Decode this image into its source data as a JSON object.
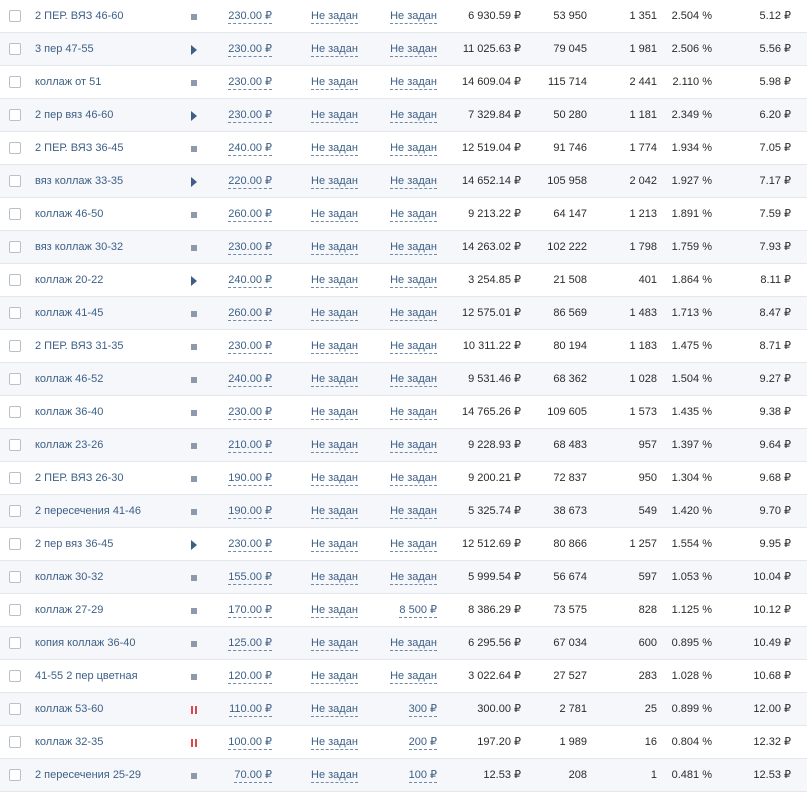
{
  "currency": "₽",
  "rows": [
    {
      "name": "2 ПЕР. ВЯЗ 46-60",
      "status": "active",
      "bid": "230.00 ₽",
      "limit_day": "Не задан",
      "limit_total": "Не задан",
      "spent": "6 930.59 ₽",
      "impressions": "53 950",
      "clicks": "1 351",
      "ctr": "2.504 %",
      "cpc": "5.12 ₽"
    },
    {
      "name": "3 пер 47-55",
      "status": "play",
      "bid": "230.00 ₽",
      "limit_day": "Не задан",
      "limit_total": "Не задан",
      "spent": "11 025.63 ₽",
      "impressions": "79 045",
      "clicks": "1 981",
      "ctr": "2.506 %",
      "cpc": "5.56 ₽"
    },
    {
      "name": "коллаж от 51",
      "status": "active",
      "bid": "230.00 ₽",
      "limit_day": "Не задан",
      "limit_total": "Не задан",
      "spent": "14 609.04 ₽",
      "impressions": "115 714",
      "clicks": "2 441",
      "ctr": "2.110 %",
      "cpc": "5.98 ₽"
    },
    {
      "name": "2 пер вяз 46-60",
      "status": "play",
      "bid": "230.00 ₽",
      "limit_day": "Не задан",
      "limit_total": "Не задан",
      "spent": "7 329.84 ₽",
      "impressions": "50 280",
      "clicks": "1 181",
      "ctr": "2.349 %",
      "cpc": "6.20 ₽"
    },
    {
      "name": "2 ПЕР. ВЯЗ 36-45",
      "status": "active",
      "bid": "240.00 ₽",
      "limit_day": "Не задан",
      "limit_total": "Не задан",
      "spent": "12 519.04 ₽",
      "impressions": "91 746",
      "clicks": "1 774",
      "ctr": "1.934 %",
      "cpc": "7.05 ₽"
    },
    {
      "name": "вяз коллаж 33-35",
      "status": "play",
      "bid": "220.00 ₽",
      "limit_day": "Не задан",
      "limit_total": "Не задан",
      "spent": "14 652.14 ₽",
      "impressions": "105 958",
      "clicks": "2 042",
      "ctr": "1.927 %",
      "cpc": "7.17 ₽"
    },
    {
      "name": "коллаж 46-50",
      "status": "active",
      "bid": "260.00 ₽",
      "limit_day": "Не задан",
      "limit_total": "Не задан",
      "spent": "9 213.22 ₽",
      "impressions": "64 147",
      "clicks": "1 213",
      "ctr": "1.891 %",
      "cpc": "7.59 ₽"
    },
    {
      "name": "вяз коллаж 30-32",
      "status": "active",
      "bid": "230.00 ₽",
      "limit_day": "Не задан",
      "limit_total": "Не задан",
      "spent": "14 263.02 ₽",
      "impressions": "102 222",
      "clicks": "1 798",
      "ctr": "1.759 %",
      "cpc": "7.93 ₽"
    },
    {
      "name": "коллаж 20-22",
      "status": "play",
      "bid": "240.00 ₽",
      "limit_day": "Не задан",
      "limit_total": "Не задан",
      "spent": "3 254.85 ₽",
      "impressions": "21 508",
      "clicks": "401",
      "ctr": "1.864 %",
      "cpc": "8.11 ₽"
    },
    {
      "name": "коллаж 41-45",
      "status": "active",
      "bid": "260.00 ₽",
      "limit_day": "Не задан",
      "limit_total": "Не задан",
      "spent": "12 575.01 ₽",
      "impressions": "86 569",
      "clicks": "1 483",
      "ctr": "1.713 %",
      "cpc": "8.47 ₽"
    },
    {
      "name": "2 ПЕР. ВЯЗ 31-35",
      "status": "active",
      "bid": "230.00 ₽",
      "limit_day": "Не задан",
      "limit_total": "Не задан",
      "spent": "10 311.22 ₽",
      "impressions": "80 194",
      "clicks": "1 183",
      "ctr": "1.475 %",
      "cpc": "8.71 ₽"
    },
    {
      "name": "коллаж 46-52",
      "status": "active",
      "bid": "240.00 ₽",
      "limit_day": "Не задан",
      "limit_total": "Не задан",
      "spent": "9 531.46 ₽",
      "impressions": "68 362",
      "clicks": "1 028",
      "ctr": "1.504 %",
      "cpc": "9.27 ₽"
    },
    {
      "name": "коллаж 36-40",
      "status": "active",
      "bid": "230.00 ₽",
      "limit_day": "Не задан",
      "limit_total": "Не задан",
      "spent": "14 765.26 ₽",
      "impressions": "109 605",
      "clicks": "1 573",
      "ctr": "1.435 %",
      "cpc": "9.38 ₽"
    },
    {
      "name": "коллаж 23-26",
      "status": "active",
      "bid": "210.00 ₽",
      "limit_day": "Не задан",
      "limit_total": "Не задан",
      "spent": "9 228.93 ₽",
      "impressions": "68 483",
      "clicks": "957",
      "ctr": "1.397 %",
      "cpc": "9.64 ₽"
    },
    {
      "name": "2 ПЕР. ВЯЗ 26-30",
      "status": "active",
      "bid": "190.00 ₽",
      "limit_day": "Не задан",
      "limit_total": "Не задан",
      "spent": "9 200.21 ₽",
      "impressions": "72 837",
      "clicks": "950",
      "ctr": "1.304 %",
      "cpc": "9.68 ₽"
    },
    {
      "name": "2 пересечения 41-46",
      "status": "active",
      "bid": "190.00 ₽",
      "limit_day": "Не задан",
      "limit_total": "Не задан",
      "spent": "5 325.74 ₽",
      "impressions": "38 673",
      "clicks": "549",
      "ctr": "1.420 %",
      "cpc": "9.70 ₽"
    },
    {
      "name": "2 пер вяз 36-45",
      "status": "play",
      "bid": "230.00 ₽",
      "limit_day": "Не задан",
      "limit_total": "Не задан",
      "spent": "12 512.69 ₽",
      "impressions": "80 866",
      "clicks": "1 257",
      "ctr": "1.554 %",
      "cpc": "9.95 ₽"
    },
    {
      "name": "коллаж 30-32",
      "status": "active",
      "bid": "155.00 ₽",
      "limit_day": "Не задан",
      "limit_total": "Не задан",
      "spent": "5 999.54 ₽",
      "impressions": "56 674",
      "clicks": "597",
      "ctr": "1.053 %",
      "cpc": "10.04 ₽"
    },
    {
      "name": "коллаж 27-29",
      "status": "active",
      "bid": "170.00 ₽",
      "limit_day": "Не задан",
      "limit_total": "8 500 ₽",
      "spent": "8 386.29 ₽",
      "impressions": "73 575",
      "clicks": "828",
      "ctr": "1.125 %",
      "cpc": "10.12 ₽"
    },
    {
      "name": "копия коллаж 36-40",
      "status": "active",
      "bid": "125.00 ₽",
      "limit_day": "Не задан",
      "limit_total": "Не задан",
      "spent": "6 295.56 ₽",
      "impressions": "67 034",
      "clicks": "600",
      "ctr": "0.895 %",
      "cpc": "10.49 ₽"
    },
    {
      "name": "41-55 2 пер цветная",
      "status": "active",
      "bid": "120.00 ₽",
      "limit_day": "Не задан",
      "limit_total": "Не задан",
      "spent": "3 022.64 ₽",
      "impressions": "27 527",
      "clicks": "283",
      "ctr": "1.028 %",
      "cpc": "10.68 ₽"
    },
    {
      "name": "коллаж 53-60",
      "status": "paused",
      "bid": "110.00 ₽",
      "limit_day": "Не задан",
      "limit_total": "300 ₽",
      "spent": "300.00 ₽",
      "impressions": "2 781",
      "clicks": "25",
      "ctr": "0.899 %",
      "cpc": "12.00 ₽"
    },
    {
      "name": "коллаж 32-35",
      "status": "paused",
      "bid": "100.00 ₽",
      "limit_day": "Не задан",
      "limit_total": "200 ₽",
      "spent": "197.20 ₽",
      "impressions": "1 989",
      "clicks": "16",
      "ctr": "0.804 %",
      "cpc": "12.32 ₽"
    },
    {
      "name": "2 пересечения 25-29",
      "status": "active",
      "bid": "70.00 ₽",
      "limit_day": "Не задан",
      "limit_total": "100 ₽",
      "spent": "12.53 ₽",
      "impressions": "208",
      "clicks": "1",
      "ctr": "0.481 %",
      "cpc": "12.53 ₽"
    }
  ]
}
